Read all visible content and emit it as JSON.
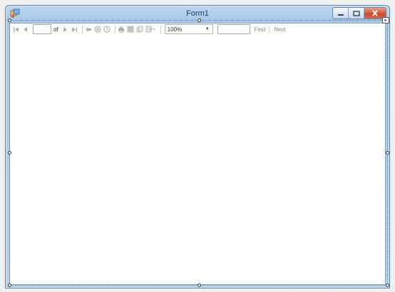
{
  "window": {
    "title": "Form1",
    "icon": "form-app-icon",
    "caption_buttons": [
      "minimize-icon",
      "maximize-icon",
      "close-icon"
    ]
  },
  "toolbar": {
    "page_value": "",
    "of_label": "of",
    "zoom_value": "100%",
    "find_value": "",
    "find_label": "Find",
    "next_label": "Next",
    "icons": {
      "first_page": "first-page-icon",
      "previous_page": "previous-page-icon",
      "next_page": "next-page-icon",
      "last_page": "last-page-icon",
      "back": "back-icon",
      "stop": "stop-icon",
      "refresh": "refresh-icon",
      "print": "print-icon",
      "print_layout": "print-layout-icon",
      "page_setup": "page-setup-icon",
      "export": "export-icon"
    }
  },
  "colors": {
    "title_bar": "#a9c9ea",
    "close_button": "#c94a2f",
    "disabled_icon": "#b0b0b0",
    "client_background": "#ffffff"
  }
}
